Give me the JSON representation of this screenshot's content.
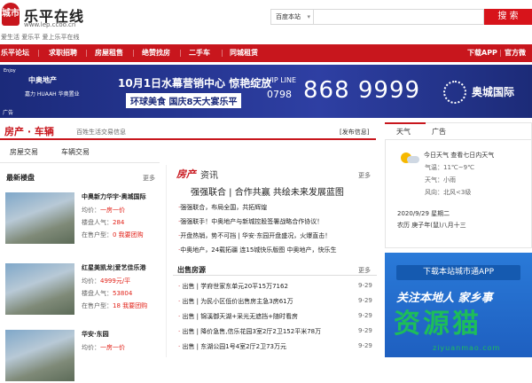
{
  "header": {
    "logo_mark": "城市",
    "logo_title": "乐平在线",
    "logo_url": "www.lep.ccoo.cn",
    "slogan": "爱生活 爱乐平 爱上乐平在线"
  },
  "search": {
    "scope": "百度本站",
    "button": "搜 索"
  },
  "nav": {
    "items": [
      "乐平论坛",
      "求职招聘",
      "房屋租售",
      "绝赞找房",
      "二手车",
      "同城租赁"
    ],
    "right": [
      "下载APP",
      "官方微信"
    ]
  },
  "banner": {
    "brand_en": "Enjoy",
    "brand": "中奥地产",
    "logos": "嘉力 HUAAH 华奥置业",
    "headline1": "10月1日水幕营销中心 惊艳绽放",
    "headline2": "环球美食 国庆8天大宴乐平",
    "vip": "VIP LINE",
    "area_code": "0798",
    "phone": "868 9999",
    "developer": "奥城国际",
    "ad": "广告"
  },
  "section": {
    "title": "房产 · 车辆",
    "subtitle": "百姓生活交易信息",
    "link": "[发布信息]"
  },
  "left_tabs": [
    "房屋交易",
    "车辆交易"
  ],
  "latest": {
    "title": "最新楼盘",
    "more": "更多",
    "items": [
      {
        "name": "中奥新力华宇·奥城国际",
        "price_label": "均价：",
        "price": "一房一价",
        "pop_label": "楼盘人气：",
        "pop": "284",
        "status_label": "在售户型：",
        "status": "0 我要团购"
      },
      {
        "name": "红星美凯龙|爱艺佳乐港",
        "price_label": "均价：",
        "price": "4999元/平",
        "pop_label": "楼盘人气：",
        "pop": "53804",
        "status_label": "在售户型：",
        "status": "18 我要团购"
      },
      {
        "name": "华安·东园",
        "price_label": "均价：",
        "price": "一房一价",
        "pop_label": "",
        "pop": "",
        "status_label": "",
        "status": ""
      }
    ]
  },
  "news": {
    "logo": "房产",
    "logo2": "资讯",
    "more": "更多",
    "headline": "强强联合 | 合作共赢 共绘未来发展蓝图",
    "items": [
      "强强联合，布局全国，共拓辉煌",
      "强强联手！中奥地产与新城控股签署战略合作协议！",
      "开盘热销，势不可挡 | 华安·东园开盘盛况，火爆直击！",
      "中奥地产，24载拓疆 连15城快乐版图 中奥地产，快乐生"
    ]
  },
  "sale": {
    "title": "出售房源",
    "more": "更多",
    "items": [
      {
        "label": "出售",
        "text": "学府世家东单元20平15万7162",
        "date": "9-29"
      },
      {
        "label": "出售",
        "text": "为民小区低价出售房主急3房61万",
        "date": "9-29"
      },
      {
        "label": "出售",
        "text": "锦溪御天湖+采光无遮挡+随时看房",
        "date": "9-29"
      },
      {
        "label": "出售",
        "text": "降价急售,信乐花园3室2厅2卫152平米78万",
        "date": "9-29"
      },
      {
        "label": "出售",
        "text": "东湖公园1号4室2厅2卫73万元",
        "date": "9-29"
      }
    ]
  },
  "weather": {
    "tabs": [
      "天气",
      "广告"
    ],
    "title": "今日天气 查看七日内天气",
    "temp": "气温：11℃~9℃",
    "condition": "天气：小雨",
    "wind": "风向：北风<3级",
    "date": "2020/9/29 星期二",
    "lunar": "农历 庚子年(鼠)八月十三"
  },
  "app": {
    "button": "下载本站城市通APP",
    "slogan": "关注本地人 家乡事"
  },
  "watermark": {
    "text": "资源猫",
    "url": "ziyuanmao.com"
  }
}
